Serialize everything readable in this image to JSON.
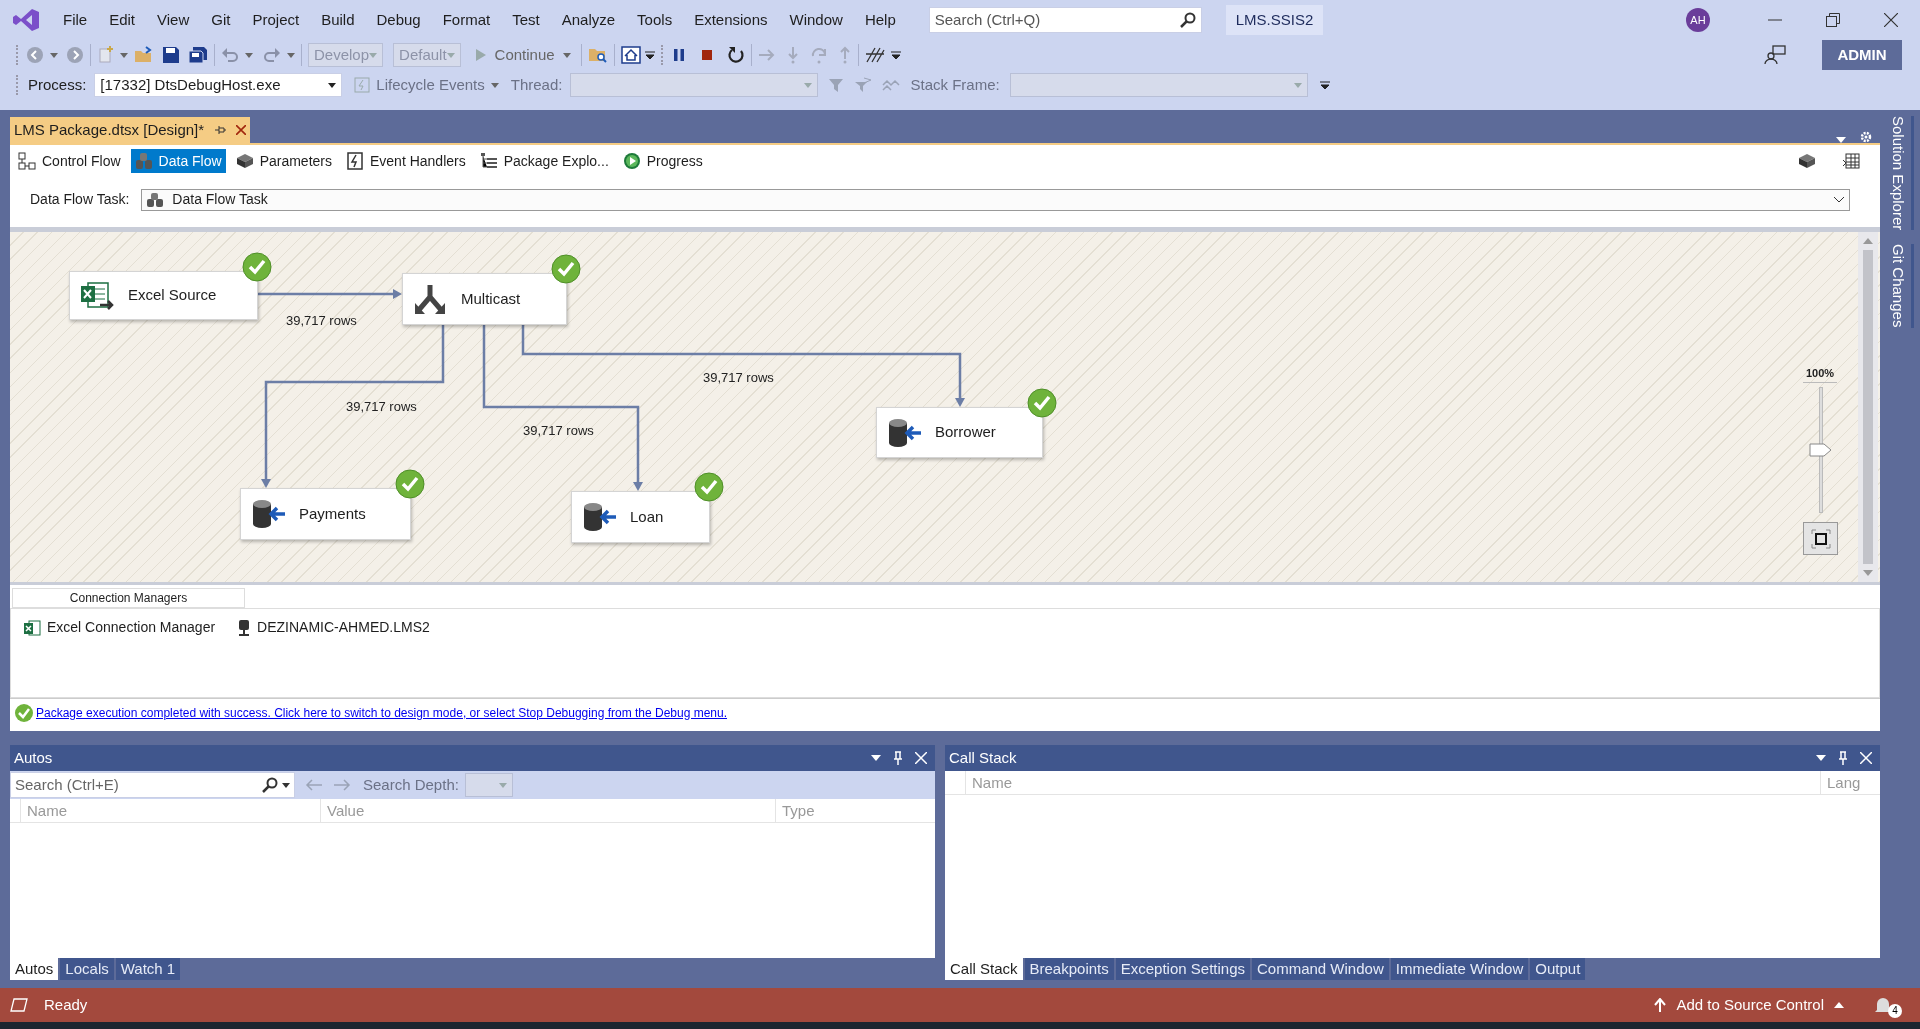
{
  "menu": [
    "File",
    "Edit",
    "View",
    "Git",
    "Project",
    "Build",
    "Debug",
    "Format",
    "Test",
    "Analyze",
    "Tools",
    "Extensions",
    "Window",
    "Help"
  ],
  "search": {
    "placeholder": "Search (Ctrl+Q)"
  },
  "solution": "LMS.SSIS2",
  "avatar": "AH",
  "account_button": "ADMIN",
  "toolbar": {
    "configuration": {
      "value": "Develop",
      "disabled": true
    },
    "platform": {
      "value": "Default",
      "disabled": true
    },
    "continue": "Continue"
  },
  "debug_location": {
    "process_label": "Process:",
    "process": "[17332] DtsDebugHost.exe",
    "lifecycle": "Lifecycle Events",
    "thread_label": "Thread:",
    "stack_frame_label": "Stack Frame:"
  },
  "document_tab": {
    "title": "LMS Package.dtsx [Design]*"
  },
  "designer_tabs": [
    {
      "label": "Control Flow",
      "selected": false
    },
    {
      "label": "Data Flow",
      "selected": true
    },
    {
      "label": "Parameters",
      "selected": false
    },
    {
      "label": "Event Handlers",
      "selected": false
    },
    {
      "label": "Package Explo...",
      "selected": false
    },
    {
      "label": "Progress",
      "selected": false
    }
  ],
  "task_picker": {
    "label": "Data Flow Task:",
    "value": "Data Flow Task"
  },
  "canvas": {
    "components": [
      {
        "name": "Excel Source",
        "kind": "source",
        "succeeded": true
      },
      {
        "name": "Multicast",
        "kind": "multicast",
        "succeeded": true
      },
      {
        "name": "Borrower",
        "kind": "destination",
        "succeeded": true
      },
      {
        "name": "Payments",
        "kind": "destination",
        "succeeded": true
      },
      {
        "name": "Loan",
        "kind": "destination",
        "succeeded": true
      }
    ],
    "paths": [
      {
        "label": "39,717 rows"
      },
      {
        "label": "39,717 rows"
      },
      {
        "label": "39,717 rows"
      },
      {
        "label": "39,717 rows"
      }
    ],
    "zoom": {
      "label": "100%",
      "level": 0.5
    }
  },
  "connection_managers": {
    "tab": "Connection Managers",
    "items": [
      {
        "name": "Excel Connection Manager",
        "kind": "excel"
      },
      {
        "name": "DEZINAMIC-AHMED.LMS2",
        "kind": "database"
      }
    ]
  },
  "status_message": "Package execution completed with success. Click here to switch to design mode, or select Stop Debugging from the Debug menu.",
  "autos": {
    "title": "Autos",
    "search_placeholder": "Search (Ctrl+E)",
    "depth_label": "Search Depth:",
    "columns": [
      "Name",
      "Value",
      "Type"
    ],
    "tabs": [
      {
        "label": "Autos",
        "selected": true
      },
      {
        "label": "Locals",
        "selected": false
      },
      {
        "label": "Watch 1",
        "selected": false
      }
    ]
  },
  "call_stack": {
    "title": "Call Stack",
    "columns": [
      "Name",
      "Lang"
    ],
    "tabs": [
      {
        "label": "Call Stack",
        "selected": true
      },
      {
        "label": "Breakpoints",
        "selected": false
      },
      {
        "label": "Exception Settings",
        "selected": false
      },
      {
        "label": "Command Window",
        "selected": false
      },
      {
        "label": "Immediate Window",
        "selected": false
      },
      {
        "label": "Output",
        "selected": false
      }
    ]
  },
  "status_bar": {
    "text": "Ready",
    "source_control": "Add to Source Control",
    "notifications": "4"
  },
  "side_rail": [
    "Solution Explorer",
    "Git Changes"
  ]
}
